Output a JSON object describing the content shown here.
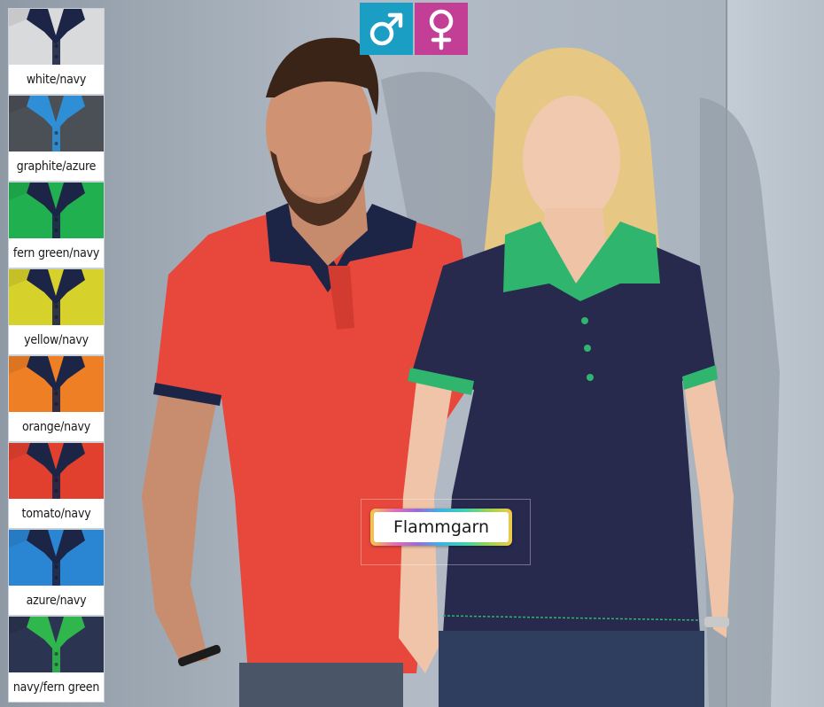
{
  "swatches": [
    {
      "label": "white/navy",
      "body": "#d9dadc",
      "collar": "#1d2547",
      "placket": "#1d2547"
    },
    {
      "label": "graphite/azure",
      "body": "#4b4f56",
      "collar": "#2f8fd6",
      "placket": "#2f8fd6"
    },
    {
      "label": "fern green/navy",
      "body": "#21b04f",
      "collar": "#1d2547",
      "placket": "#1d2547"
    },
    {
      "label": "yellow/navy",
      "body": "#d6d12b",
      "collar": "#1d2547",
      "placket": "#1d2547"
    },
    {
      "label": "orange/navy",
      "body": "#ef7f24",
      "collar": "#1d2547",
      "placket": "#1d2547"
    },
    {
      "label": "tomato/navy",
      "body": "#e2402f",
      "collar": "#1d2547",
      "placket": "#1d2547"
    },
    {
      "label": "azure/navy",
      "body": "#2a86d3",
      "collar": "#1d2547",
      "placket": "#1d2547"
    },
    {
      "label": "navy/fern green",
      "body": "#2b3450",
      "collar": "#2fb64c",
      "placket": "#2fb64c"
    }
  ],
  "gender_filter": {
    "male": {
      "icon": "male-symbol-icon",
      "color": "#1a9ec4"
    },
    "female": {
      "icon": "female-symbol-icon",
      "color": "#c33f95"
    }
  },
  "badge": {
    "label": "Flammgarn"
  },
  "colors": {
    "wall": "#a9b3bd",
    "man_shirt": "#e8473b",
    "woman_shirt": "#27294d",
    "woman_trim": "#2fb56e"
  }
}
